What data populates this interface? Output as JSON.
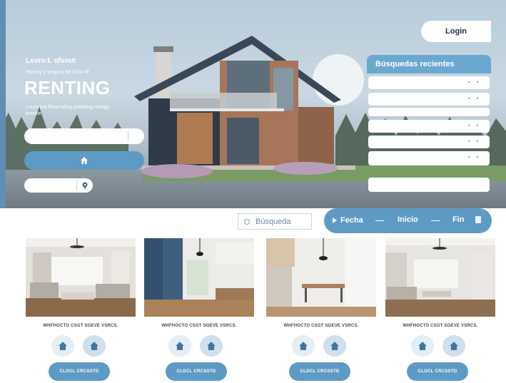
{
  "hero": {
    "brand_small": "Lovro Ł ofvout",
    "tagline": "Poczey y emg nu ed Di bi oll",
    "title": "RENTING",
    "description": "Loura eal fithamaling prebbing rentigy ionstlie.",
    "home_icon": "home-icon",
    "pin_icon": "map-pin-icon"
  },
  "header": {
    "login_label": "Login"
  },
  "recent_searches": {
    "title": "Búsquedas recientes",
    "rows": [
      {
        "dots": "• •"
      },
      {
        "dots": "• •"
      },
      {
        "dots": ""
      },
      {
        "dots": "• •"
      },
      {
        "dots": "• •"
      },
      {
        "dots": "• •"
      },
      {
        "dots": ""
      }
    ]
  },
  "search": {
    "label": "Búsqueda",
    "icon": "search-icon"
  },
  "dates": {
    "fecha_label": "Fecha",
    "inicio_label": "Inicio",
    "fin_label": "Fin",
    "icon": "calendar-icon"
  },
  "listings": [
    {
      "caption": "WHFHOCTO CSGT SGEVE VSRCS.",
      "button_label": "CLOCL CRCSSTD"
    },
    {
      "caption": "WHFHOCTO CSGT SGEVE VSRCS.",
      "button_label": "CLOCL CRCSSTD"
    },
    {
      "caption": "WHFHOCTO CSGT SGEVE VSRCS.",
      "button_label": "CLOCL CRCSSTD"
    },
    {
      "caption": "WHFHOCTO CSGT SGEVE VSRCS.",
      "button_label": "CLOCL CRCSSTD"
    }
  ],
  "colors": {
    "accent": "#5e9bc4",
    "accent_light": "#6aa8d0",
    "panel": "#ffffff",
    "text_dark": "#1f2d3a"
  }
}
